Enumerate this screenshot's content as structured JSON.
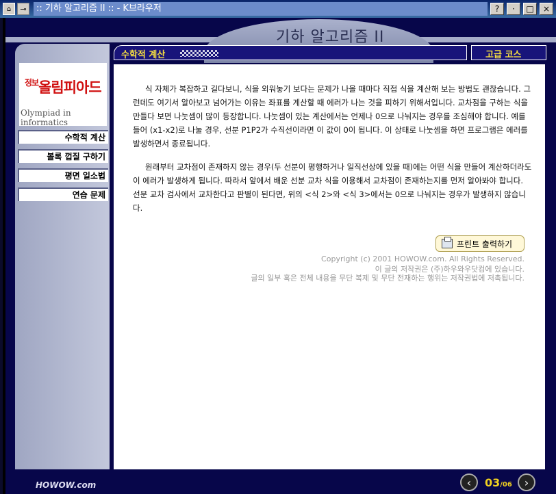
{
  "window": {
    "title": ":: 기하 알고리즘 II :: - K브라우저",
    "help_label": "?",
    "minimize_label": "·",
    "maximize_label": "□",
    "close_label": "×"
  },
  "header": {
    "app_title": "기하 알고리즘 II"
  },
  "logo": {
    "ko_small": "정보",
    "ko": "올림피아드",
    "en": "Olympiad in informatics"
  },
  "sidebar": {
    "items": [
      {
        "label": "수학적 계산"
      },
      {
        "label": "볼록 껍질 구하기"
      },
      {
        "label": "평면 일소법"
      },
      {
        "label": "연습 문제"
      }
    ]
  },
  "section": {
    "title": "수학적 계산",
    "level": "고급 코스"
  },
  "content": {
    "paragraph1": "식 자체가 복잡하고 길다보니, 식을 외워놓기 보다는 문제가 나올 때마다 직접 식을 계산해 보는 방법도 괜찮습니다. 그런데도 여기서 알아보고 넘어가는 이유는 좌표를 계산할 때 에러가 나는 것을 피하기 위해서입니다. 교차점을 구하는 식을 만들다 보면 나눗셈이 많이 등장합니다. 나눗셈이 있는 계산에서는 언제나 0으로 나눠지는 경우를 조심해야 합니다. 예를 들어 (x1-x2)로 나눌 경우, 선분 P1P2가 수직선이라면 이 값이 0이 됩니다. 이 상태로 나눗셈을 하면 프로그램은 에러를 발생하면서 종료됩니다.",
    "paragraph2": "원래부터 교차점이 존재하지 않는 경우(두 선분이 평행하거나 일직선상에 있을 때)에는 어떤 식을 만들어 계산하더라도 이 에러가 발생하게 됩니다. 따라서 앞에서 배운 선분 교차 식을 이용해서 교차점이 존재하는지를 먼저 알아봐야 합니다. 선분 교차 검사에서 교차한다고 판별이 된다면, 위의 <식 2>와 <식 3>에서는 0으로 나눠지는 경우가 발생하지 않습니다.",
    "print_label": "프린트 출력하기",
    "copyright1": "Copyright (c) 2001 HOWOW.com. All Rights Reserved.",
    "copyright2": "이 글의 저작권은 (주)하우와우닷컴에 있습니다.",
    "copyright3": "글의 일부 혹은 전체 내용을 무단 복제 및 무단 전재하는 행위는 저작권법에 저촉됩니다."
  },
  "footer": {
    "brand": "HOWOW.com",
    "page_current": "03",
    "page_total": "/06",
    "prev_label": "‹",
    "next_label": "›"
  }
}
